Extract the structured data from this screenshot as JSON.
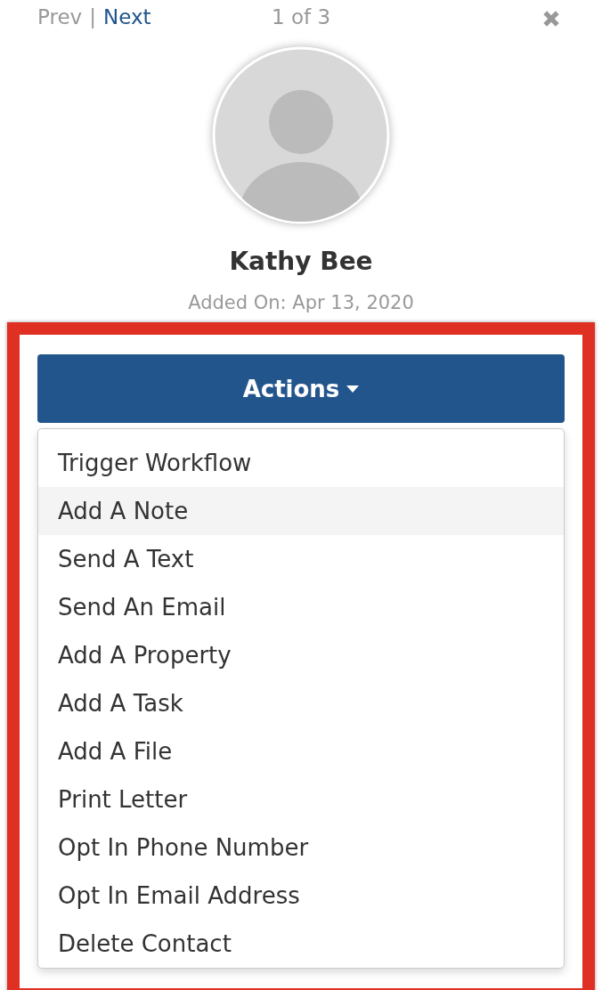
{
  "pager": {
    "prev": "Prev",
    "separator": "|",
    "next": "Next",
    "position": "1 of 3"
  },
  "contact": {
    "name": "Kathy Bee",
    "added_on": "Added On: Apr 13, 2020"
  },
  "actions_button": {
    "label": "Actions",
    "expanded": true
  },
  "menu": [
    {
      "label": "Trigger Workflow",
      "selected": false
    },
    {
      "label": "Add A Note",
      "selected": true
    },
    {
      "label": "Send A Text",
      "selected": false
    },
    {
      "label": "Send An Email",
      "selected": false
    },
    {
      "label": "Add A Property",
      "selected": false
    },
    {
      "label": "Add A Task",
      "selected": false
    },
    {
      "label": "Add A File",
      "selected": false
    },
    {
      "label": "Print Letter",
      "selected": false
    },
    {
      "label": "Opt In Phone Number",
      "selected": false
    },
    {
      "label": "Opt In Email Address",
      "selected": false
    },
    {
      "label": "Delete Contact",
      "selected": false
    }
  ]
}
